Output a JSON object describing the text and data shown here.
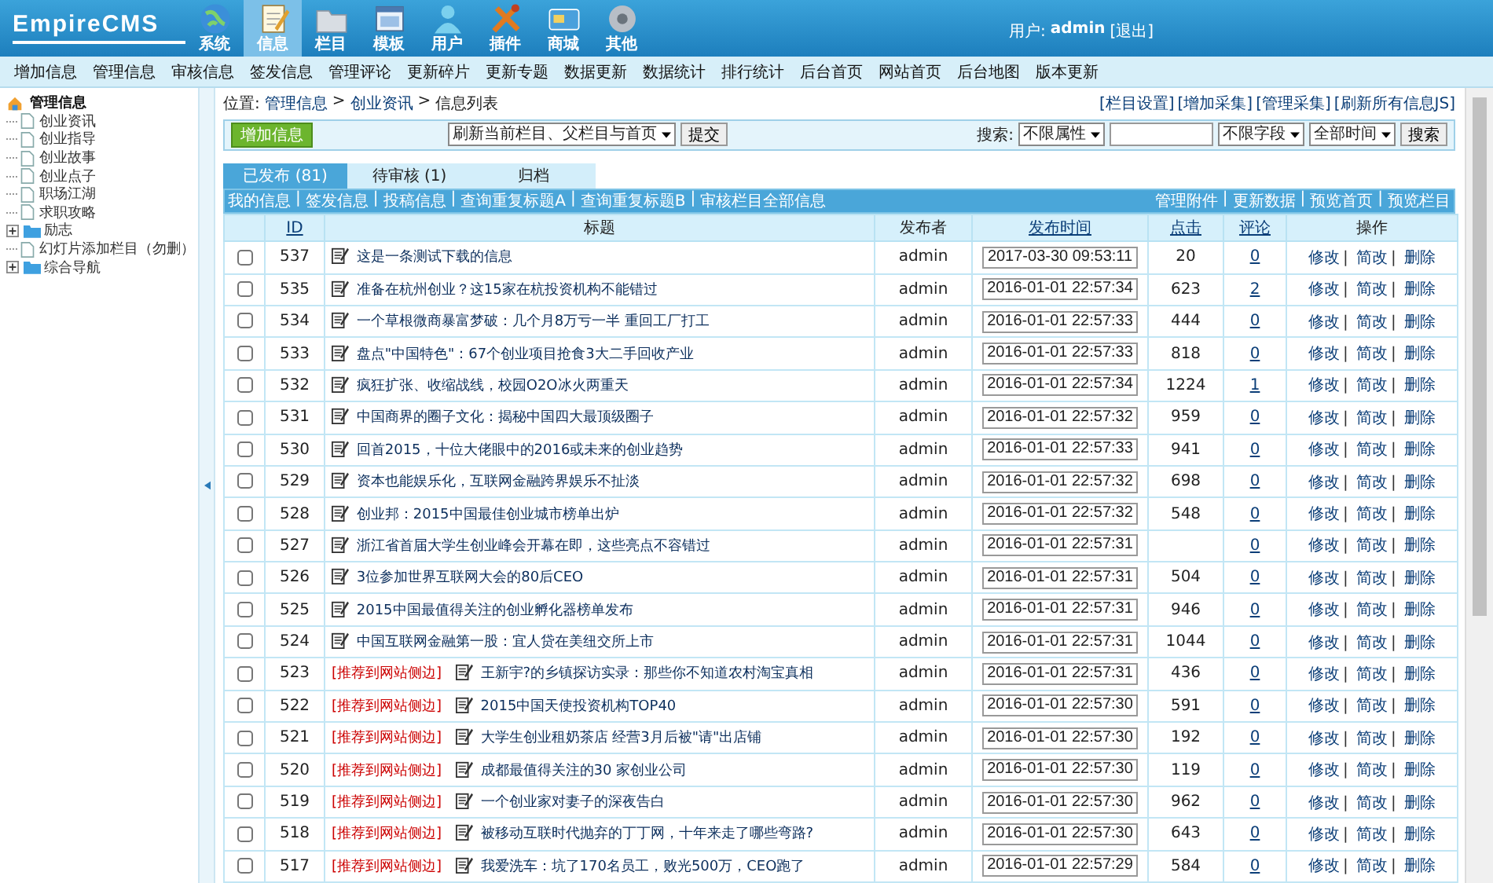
{
  "header": {
    "logo": "EmpireCMS",
    "nav": [
      {
        "label": "系统",
        "selected": false
      },
      {
        "label": "信息",
        "selected": true
      },
      {
        "label": "栏目",
        "selected": false
      },
      {
        "label": "模板",
        "selected": false
      },
      {
        "label": "用户",
        "selected": false
      },
      {
        "label": "插件",
        "selected": false
      },
      {
        "label": "商城",
        "selected": false
      },
      {
        "label": "其他",
        "selected": false
      }
    ],
    "user_label": "用户:",
    "user": "admin",
    "logout": "[退出]"
  },
  "menu": [
    "增加信息",
    "管理信息",
    "审核信息",
    "签发信息",
    "管理评论",
    "更新碎片",
    "更新专题",
    "数据更新",
    "数据统计",
    "排行统计",
    "后台首页",
    "网站首页",
    "后台地图",
    "版本更新"
  ],
  "sidebar": {
    "root": {
      "label": "管理信息",
      "expanded": true,
      "children": [
        {
          "label": "创业资讯",
          "kind": "page"
        },
        {
          "label": "创业指导",
          "kind": "page"
        },
        {
          "label": "创业故事",
          "kind": "page"
        },
        {
          "label": "创业点子",
          "kind": "page"
        },
        {
          "label": "职场江湖",
          "kind": "page"
        },
        {
          "label": "求职攻略",
          "kind": "page"
        },
        {
          "label": "励志",
          "kind": "folder",
          "expanded": false
        },
        {
          "label": "幻灯片添加栏目（勿删）",
          "kind": "page"
        },
        {
          "label": "综合导航",
          "kind": "folder",
          "expanded": false
        }
      ]
    }
  },
  "breadcrumb": {
    "label": "位置:",
    "separator": ">",
    "items": [
      "管理信息",
      "创业资讯",
      "信息列表"
    ]
  },
  "top_links": [
    "[栏目设置]",
    "[增加采集]",
    "[管理采集]",
    "[刷新所有信息JS]"
  ],
  "toolbar": {
    "add_button": "增加信息",
    "refresh_select": "刷新当前栏目、父栏目与首页",
    "submit_button": "提交",
    "search_label": "搜索:",
    "attr_select": "不限属性",
    "field_select": "不限字段",
    "time_select": "全部时间",
    "search_button": "搜索"
  },
  "tabs": [
    {
      "label": "已发布 (81)",
      "selected": true
    },
    {
      "label": "待审核 (1)",
      "selected": false
    },
    {
      "label": "归档",
      "selected": false
    }
  ],
  "sub_links": {
    "separator": "|",
    "left": [
      "我的信息",
      "签发信息",
      "投稿信息",
      "查询重复标题A",
      "查询重复标题B",
      "审核栏目全部信息"
    ],
    "right": [
      "管理附件",
      "更新数据",
      "预览首页",
      "预览栏目"
    ]
  },
  "table": {
    "columns": [
      {
        "label": "ID",
        "link": true
      },
      {
        "label": "标题",
        "link": false
      },
      {
        "label": "发布者",
        "link": false
      },
      {
        "label": "发布时间",
        "link": true
      },
      {
        "label": "点击",
        "link": true
      },
      {
        "label": "评论",
        "link": true
      },
      {
        "label": "操作",
        "link": false
      }
    ],
    "rows": [
      {
        "checked": false,
        "id": "537",
        "title": "这是一条测试下载的信息",
        "publisher": "admin",
        "time": "2017-03-30 09:53:11",
        "clicks": "20",
        "comments": "0",
        "actions": [
          "修改",
          "简改",
          "删除"
        ]
      },
      {
        "checked": false,
        "id": "535",
        "title": "准备在杭州创业？这15家在杭投资机构不能错过",
        "publisher": "admin",
        "time": "2016-01-01 22:57:34",
        "clicks": "623",
        "comments": "2",
        "actions": [
          "修改",
          "简改",
          "删除"
        ]
      },
      {
        "checked": false,
        "id": "534",
        "title": "一个草根微商暴富梦破：几个月8万亏一半 重回工厂打工",
        "publisher": "admin",
        "time": "2016-01-01 22:57:33",
        "clicks": "444",
        "comments": "0",
        "actions": [
          "修改",
          "简改",
          "删除"
        ]
      },
      {
        "checked": false,
        "id": "533",
        "title": "盘点\"中国特色\"：67个创业项目抢食3大二手回收产业",
        "publisher": "admin",
        "time": "2016-01-01 22:57:33",
        "clicks": "818",
        "comments": "0",
        "actions": [
          "修改",
          "简改",
          "删除"
        ]
      },
      {
        "checked": false,
        "id": "532",
        "title": "疯狂扩张、收缩战线，校园O2O冰火两重天",
        "publisher": "admin",
        "time": "2016-01-01 22:57:34",
        "clicks": "1224",
        "comments": "1",
        "actions": [
          "修改",
          "简改",
          "删除"
        ]
      },
      {
        "checked": false,
        "id": "531",
        "title": "中国商界的圈子文化：揭秘中国四大最顶级圈子",
        "publisher": "admin",
        "time": "2016-01-01 22:57:32",
        "clicks": "959",
        "comments": "0",
        "actions": [
          "修改",
          "简改",
          "删除"
        ]
      },
      {
        "checked": false,
        "id": "530",
        "title": "回首2015，十位大佬眼中的2016或未来的创业趋势",
        "publisher": "admin",
        "time": "2016-01-01 22:57:33",
        "clicks": "941",
        "comments": "0",
        "actions": [
          "修改",
          "简改",
          "删除"
        ]
      },
      {
        "checked": false,
        "id": "529",
        "title": "资本也能娱乐化，互联网金融跨界娱乐不扯淡",
        "publisher": "admin",
        "time": "2016-01-01 22:57:32",
        "clicks": "698",
        "comments": "0",
        "actions": [
          "修改",
          "简改",
          "删除"
        ]
      },
      {
        "checked": false,
        "id": "528",
        "title": "创业邦：2015中国最佳创业城市榜单出炉",
        "publisher": "admin",
        "time": "2016-01-01 22:57:32",
        "clicks": "548",
        "comments": "0",
        "actions": [
          "修改",
          "简改",
          "删除"
        ]
      },
      {
        "checked": false,
        "id": "527",
        "title": "浙江省首届大学生创业峰会开幕在即，这些亮点不容错过",
        "publisher": "admin",
        "time": "2016-01-01 22:57:31",
        "clicks": "",
        "comments": "0",
        "actions": [
          "修改",
          "简改",
          "删除"
        ]
      },
      {
        "checked": false,
        "id": "526",
        "title": "3位参加世界互联网大会的80后CEO",
        "publisher": "admin",
        "time": "2016-01-01 22:57:31",
        "clicks": "504",
        "comments": "0",
        "actions": [
          "修改",
          "简改",
          "删除"
        ]
      },
      {
        "checked": false,
        "id": "525",
        "title": "2015中国最值得关注的创业孵化器榜单发布",
        "publisher": "admin",
        "time": "2016-01-01 22:57:31",
        "clicks": "946",
        "comments": "0",
        "actions": [
          "修改",
          "简改",
          "删除"
        ]
      },
      {
        "checked": false,
        "id": "524",
        "title": "中国互联网金融第一股：宜人贷在美纽交所上市",
        "publisher": "admin",
        "time": "2016-01-01 22:57:31",
        "clicks": "1044",
        "comments": "0",
        "actions": [
          "修改",
          "简改",
          "删除"
        ]
      },
      {
        "checked": false,
        "id": "523",
        "tag": "[推荐到网站侧边]",
        "title": "王新宇?的乡镇探访实录：那些你不知道农村淘宝真相",
        "publisher": "admin",
        "time": "2016-01-01 22:57:31",
        "clicks": "436",
        "comments": "0",
        "actions": [
          "修改",
          "简改",
          "删除"
        ]
      },
      {
        "checked": false,
        "id": "522",
        "tag": "[推荐到网站侧边]",
        "title": "2015中国天使投资机构TOP40",
        "publisher": "admin",
        "time": "2016-01-01 22:57:30",
        "clicks": "591",
        "comments": "0",
        "actions": [
          "修改",
          "简改",
          "删除"
        ]
      },
      {
        "checked": false,
        "id": "521",
        "tag": "[推荐到网站侧边]",
        "title": "大学生创业租奶茶店 经营3月后被\"请\"出店铺",
        "publisher": "admin",
        "time": "2016-01-01 22:57:30",
        "clicks": "192",
        "comments": "0",
        "actions": [
          "修改",
          "简改",
          "删除"
        ]
      },
      {
        "checked": false,
        "id": "520",
        "tag": "[推荐到网站侧边]",
        "title": "成都最值得关注的30 家创业公司",
        "publisher": "admin",
        "time": "2016-01-01 22:57:30",
        "clicks": "119",
        "comments": "0",
        "actions": [
          "修改",
          "简改",
          "删除"
        ]
      },
      {
        "checked": false,
        "id": "519",
        "tag": "[推荐到网站侧边]",
        "title": "一个创业家对妻子的深夜告白",
        "publisher": "admin",
        "time": "2016-01-01 22:57:30",
        "clicks": "962",
        "comments": "0",
        "actions": [
          "修改",
          "简改",
          "删除"
        ]
      },
      {
        "checked": false,
        "id": "518",
        "tag": "[推荐到网站侧边]",
        "title": "被移动互联时代抛弃的丁丁网，十年来走了哪些弯路?",
        "publisher": "admin",
        "time": "2016-01-01 22:57:30",
        "clicks": "643",
        "comments": "0",
        "actions": [
          "修改",
          "简改",
          "删除"
        ]
      },
      {
        "checked": false,
        "id": "517",
        "tag": "[推荐到网站侧边]",
        "title": "我爱洗车：坑了170名员工，败光500万，CEO跑了",
        "publisher": "admin",
        "time": "2016-01-01 22:57:29",
        "clicks": "584",
        "comments": "0",
        "actions": [
          "修改",
          "简改",
          "删除"
        ]
      }
    ]
  }
}
